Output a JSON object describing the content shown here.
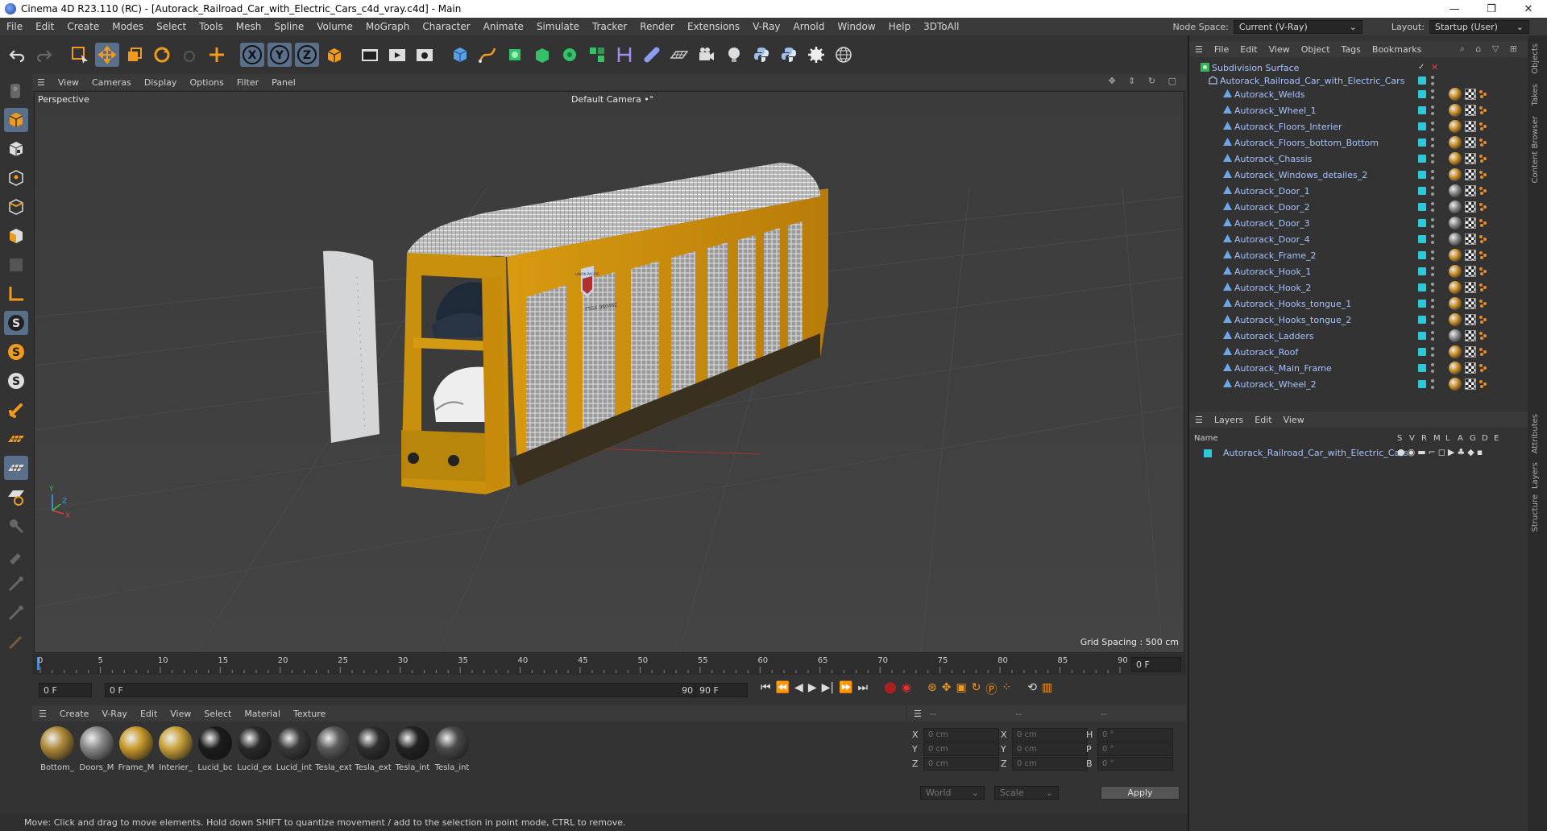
{
  "window": {
    "title": "Cinema 4D R23.110 (RC) - [Autorack_Railroad_Car_with_Electric_Cars_c4d_vray.c4d] - Main",
    "controls": [
      "—",
      "❐",
      "✕"
    ]
  },
  "menubar": {
    "items": [
      "File",
      "Edit",
      "Create",
      "Modes",
      "Select",
      "Tools",
      "Mesh",
      "Spline",
      "Volume",
      "MoGraph",
      "Character",
      "Animate",
      "Simulate",
      "Tracker",
      "Render",
      "Extensions",
      "V-Ray",
      "Arnold",
      "Window",
      "Help",
      "3DToAll"
    ],
    "node_space_label": "Node Space:",
    "node_space_value": "Current (V-Ray)",
    "layout_label": "Layout:",
    "layout_value": "Startup (User)"
  },
  "toolbar": {
    "axis_labels": [
      "X",
      "Y",
      "Z"
    ]
  },
  "viewport": {
    "menu": [
      "View",
      "Cameras",
      "Display",
      "Options",
      "Filter",
      "Panel"
    ],
    "label": "Perspective",
    "camera": "Default Camera",
    "camera_suffix": "•°",
    "grid_spacing": "Grid Spacing : 500 cm",
    "axis_x": "X",
    "axis_y": "Y",
    "axis_z": "Z",
    "herald_text": "UNION PACIFIC",
    "car_number": "TTGX 980482"
  },
  "timeline": {
    "ticks": [
      "0",
      "5",
      "10",
      "15",
      "20",
      "25",
      "30",
      "35",
      "40",
      "45",
      "50",
      "55",
      "60",
      "65",
      "70",
      "75",
      "80",
      "85",
      "90"
    ],
    "end_field": "0 F",
    "current_frame": "0 F",
    "range_start": "0 F",
    "range_end": "90 F",
    "range_end_field": "90 F"
  },
  "materials": {
    "menu": [
      "Create",
      "V-Ray",
      "Edit",
      "View",
      "Select",
      "Material",
      "Texture"
    ],
    "items": [
      {
        "label": "Bottom_",
        "color": "#b08a3a"
      },
      {
        "label": "Doors_M",
        "color": "#8a8a8a"
      },
      {
        "label": "Frame_M",
        "color": "#c99a2e"
      },
      {
        "label": "Interier_",
        "color": "#c9a23a"
      },
      {
        "label": "Lucid_bc",
        "color": "#1c1c1c"
      },
      {
        "label": "Lucid_ex",
        "color": "#2a2a2a"
      },
      {
        "label": "Lucid_int",
        "color": "#3a3a3a"
      },
      {
        "label": "Tesla_ext",
        "color": "#5a5a5a"
      },
      {
        "label": "Tesla_ext",
        "color": "#2f2f2f"
      },
      {
        "label": "Tesla_int",
        "color": "#222222"
      },
      {
        "label": "Tesla_int",
        "color": "#4a4a4a"
      }
    ]
  },
  "coordinates": {
    "menu": [
      "--",
      "--",
      "--"
    ],
    "rows": [
      {
        "a": "X",
        "av": "0 cm",
        "b": "X",
        "bv": "0 cm",
        "c": "H",
        "cv": "0 °"
      },
      {
        "a": "Y",
        "av": "0 cm",
        "b": "Y",
        "bv": "0 cm",
        "c": "P",
        "cv": "0 °"
      },
      {
        "a": "Z",
        "av": "0 cm",
        "b": "Z",
        "bv": "0 cm",
        "c": "B",
        "cv": "0 °"
      }
    ],
    "mode_world": "World",
    "mode_scale": "Scale",
    "apply": "Apply"
  },
  "status": "Move: Click and drag to move elements. Hold down SHIFT to quantize movement / add to the selection in point mode, CTRL to remove.",
  "objects": {
    "menu": [
      "File",
      "Edit",
      "View",
      "Object",
      "Tags",
      "Bookmarks"
    ],
    "root": "Subdivision Surface",
    "group": "Autorack_Railroad_Car_with_Electric_Cars",
    "children": [
      "Autorack_Welds",
      "Autorack_Wheel_1",
      "Autorack_Floors_Interier",
      "Autorack_Floors_bottom_Bottom",
      "Autorack_Chassis",
      "Autorack_Windows_detailes_2",
      "Autorack_Door_1",
      "Autorack_Door_2",
      "Autorack_Door_3",
      "Autorack_Door_4",
      "Autorack_Frame_2",
      "Autorack_Hook_1",
      "Autorack_Hook_2",
      "Autorack_Hooks_tongue_1",
      "Autorack_Hooks_tongue_2",
      "Autorack_Ladders",
      "Autorack_Roof",
      "Autorack_Main_Frame",
      "Autorack_Wheel_2"
    ],
    "visibility_color": "#2ec8d8"
  },
  "layers": {
    "menu": [
      "Layers",
      "Edit",
      "View"
    ],
    "columns": [
      "Name",
      "S",
      "V",
      "R",
      "M",
      "L",
      "A",
      "G",
      "D",
      "E"
    ],
    "items": [
      {
        "name": "Autorack_Railroad_Car_with_Electric_Cars",
        "color": "#2ec8d8"
      }
    ]
  },
  "side_tabs": [
    "Objects",
    "Takes",
    "Content Browser",
    "Attributes",
    "Layers",
    "Structure"
  ]
}
